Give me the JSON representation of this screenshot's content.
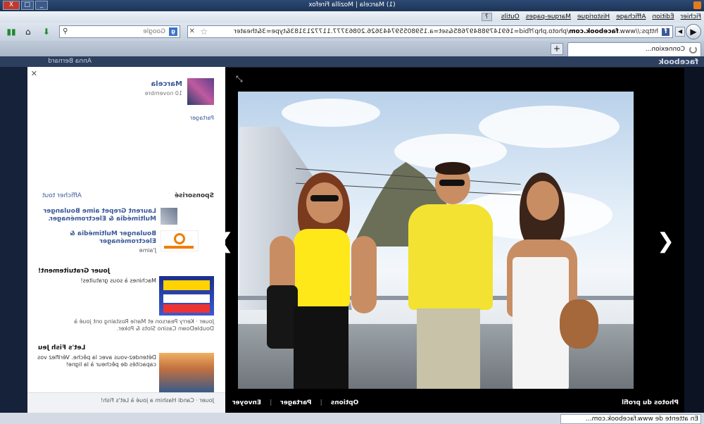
{
  "window": {
    "title": "(1) Marcela | Mozilla Firefox",
    "buttons": [
      "_",
      "□",
      "X"
    ]
  },
  "menubar": {
    "items": [
      "Fichier",
      "Édition",
      "Affichage",
      "Historique",
      "Marque-pages",
      "Outils",
      "?"
    ]
  },
  "navbar": {
    "url_prefix": "https://www.",
    "url_domain": "facebook.com",
    "url_rest": "/photo.php?fbid=169147988497685&set=a.159805597443626.20863777.1177213183&type=3&theater",
    "search_placeholder": "Google",
    "search_engine_icon": "google-icon"
  },
  "tabs": [
    {
      "label": "Connexion...",
      "loading": true
    }
  ],
  "newtab_label": "+",
  "background_page": {
    "logo": "facebook",
    "user": "Anna Bernard"
  },
  "viewer": {
    "footer_left": "Photos du profil",
    "actions": [
      "Options",
      "Partager",
      "Envoyer"
    ],
    "photo_subject": "three people posing on a viewing platform in front of a mountain"
  },
  "sidepanel": {
    "owner_name": "Marcela",
    "owner_date": "10 novembre",
    "share_label": "Partager",
    "sponsored_heading": "Sponsorisé",
    "see_all": "Afficher tout",
    "ads": [
      {
        "title": "Laurent Grepet aime Boulanger Multimédia & Electroménager.",
        "text": "",
        "meta": "",
        "image_name": "user-avatar",
        "image_colors": [
          "#6a7890",
          "#c4cad4"
        ]
      },
      {
        "title": "Boulanger Multimédia & Electroménager",
        "text": "",
        "meta": "J'aime",
        "image_name": "boulanger-logo",
        "image_colors": [
          "#ffffff",
          "#f07d00"
        ]
      },
      {
        "title": "Jouer Gratuitement!",
        "text": "Machines à sous gratuites!",
        "meta": "Jouer · Kerry Pearson et Marie Rostaing ont joué à DoubleDown Casino Slots & Poker.",
        "image_name": "casino-ad-image",
        "image_colors": [
          "#1a2f8c",
          "#ffd200"
        ]
      },
      {
        "title": "Let's Fish Jeu",
        "text": "Détendez-vous avec la pêche. Vérifiez vos capacités de pêcheur à la ligne!",
        "meta": "Jouer · Candi Hashim a joué à Let's Fish!",
        "image_name": "fishing-ad-image",
        "image_colors": [
          "#f0b060",
          "#3a5a8a"
        ]
      }
    ]
  },
  "statusbar": {
    "text": "En attente de www.facebook.com..."
  },
  "colors": {
    "titlebar": "#1d3456",
    "facebook_blue": "#3b5998",
    "viewer_bg": "#000000"
  }
}
